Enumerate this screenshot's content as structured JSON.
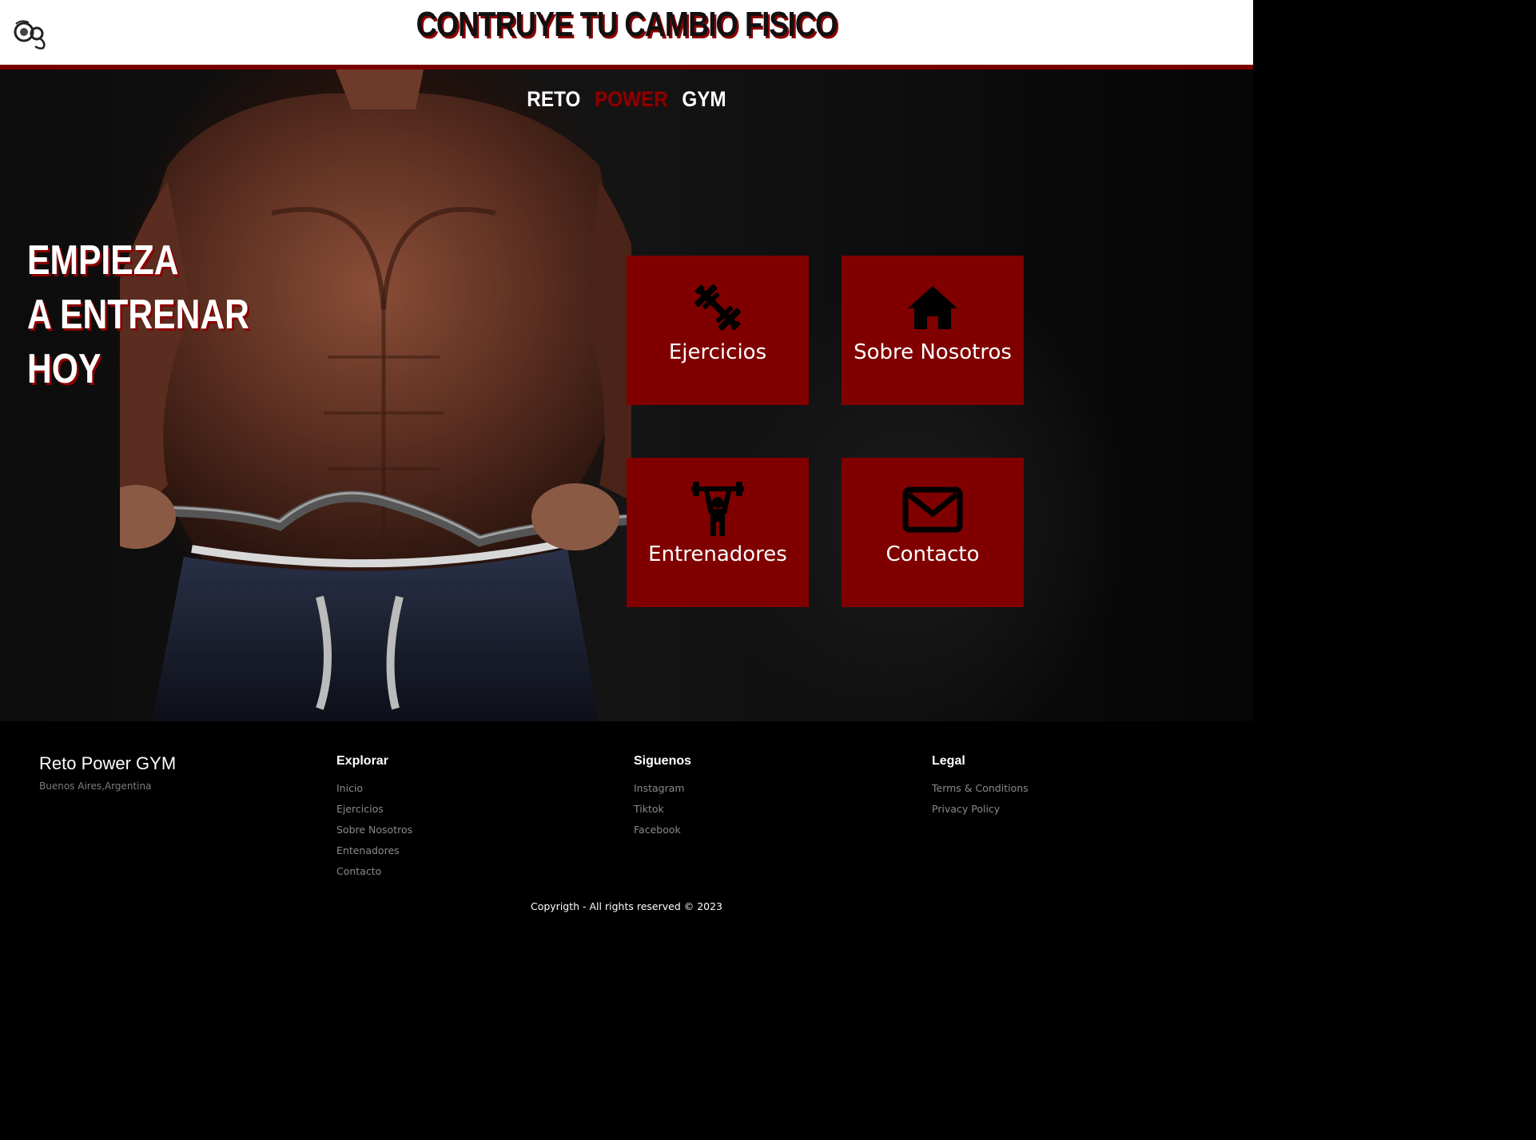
{
  "header": {
    "title": "CONTRUYE TU CAMBIO FISICO",
    "logo_icon": "dumbbell-logo-icon"
  },
  "hero": {
    "brand": [
      "RETO",
      "POWER",
      "GYM"
    ],
    "tagline": [
      "EMPIEZA",
      "A ENTRENAR",
      "HOY"
    ],
    "tiles": [
      {
        "label": "Ejercicios",
        "icon": "dumbbell-icon"
      },
      {
        "label": "Sobre Nosotros",
        "icon": "home-icon"
      },
      {
        "label": "Entrenadores",
        "icon": "weightlifter-icon"
      },
      {
        "label": "Contacto",
        "icon": "envelope-icon"
      }
    ]
  },
  "footer": {
    "brand": "Reto Power GYM",
    "location": "Buenos Aires,Argentina",
    "explore": {
      "heading": "Explorar",
      "links": [
        "Inicio",
        "Ejercicios",
        "Sobre Nosotros",
        "Entenadores",
        "Contacto"
      ]
    },
    "follow": {
      "heading": "Siguenos",
      "links": [
        "Instagram",
        "Tiktok",
        "Facebook"
      ]
    },
    "legal": {
      "heading": "Legal",
      "links": [
        "Terms & Conditions",
        "Privacy Policy"
      ]
    },
    "copyright": "Copyrigth - All rights reserved © 2023"
  },
  "colors": {
    "accent": "#800000",
    "header_bg": "#ffffff",
    "page_bg": "#000000"
  }
}
